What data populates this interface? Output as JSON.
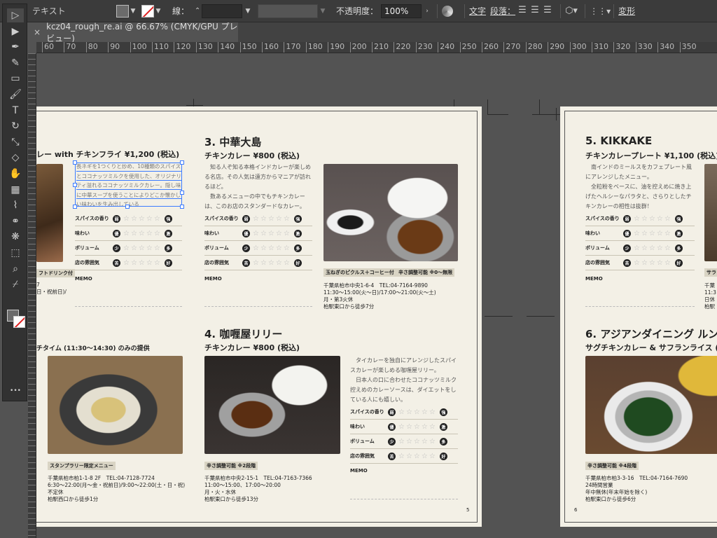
{
  "controlbar": {
    "label": "テキスト",
    "stroke_label": "線：",
    "opacity_label": "不透明度：",
    "opacity_value": "100%",
    "char_label": "文字",
    "para_label": "段落：",
    "transform_label": "変形"
  },
  "tab": {
    "close": "×",
    "title": "kcz04_rough_re.ai @ 66.67% (CMYK/GPU プレビュー)"
  },
  "ruler_ticks": [
    "60",
    "70",
    "80",
    "90",
    "100",
    "110",
    "120",
    "130",
    "140",
    "150",
    "160",
    "170",
    "180",
    "190",
    "200",
    "210",
    "220",
    "230",
    "240",
    "250",
    "260",
    "270",
    "280",
    "290",
    "300",
    "310",
    "320",
    "330",
    "340",
    "350"
  ],
  "tools": [
    {
      "name": "selection-tool-icon",
      "glyph": "▷"
    },
    {
      "name": "direct-selection-tool-icon",
      "glyph": "▶"
    },
    {
      "name": "pen-tool-icon",
      "glyph": "✒"
    },
    {
      "name": "curvature-tool-icon",
      "glyph": "✎"
    },
    {
      "name": "rectangle-tool-icon",
      "glyph": "▭"
    },
    {
      "name": "paintbrush-tool-icon",
      "glyph": "🖌"
    },
    {
      "name": "type-tool-icon",
      "glyph": "T"
    },
    {
      "name": "rotate-tool-icon",
      "glyph": "↻"
    },
    {
      "name": "scale-tool-icon",
      "glyph": "⤡"
    },
    {
      "name": "eraser-tool-icon",
      "glyph": "◇"
    },
    {
      "name": "puppet-warp-tool-icon",
      "glyph": "✋"
    },
    {
      "name": "gradient-tool-icon",
      "glyph": "▦"
    },
    {
      "name": "eyedropper-tool-icon",
      "glyph": "⌇"
    },
    {
      "name": "blend-tool-icon",
      "glyph": "⚭"
    },
    {
      "name": "symbol-sprayer-tool-icon",
      "glyph": "❋"
    },
    {
      "name": "artboard-tool-icon",
      "glyph": "⬚"
    },
    {
      "name": "zoom-tool-icon",
      "glyph": "⌕"
    },
    {
      "name": "eyedropper-2-tool-icon",
      "glyph": "⌿"
    }
  ],
  "menu": {
    "s1_title_partial": "レー with チキンフライ ¥1,200 (税込)",
    "s1_selected_text": "長ネギを1つくりと炒め、10種類のスパイスとココナッツミルクを使用した、オリジナリティ溢れるココナッツミルクカレー。隠し味に中華スープを使うことによりどこか懐かしい味わいを生み出している",
    "s1_tag_partial": "フトドリンク付",
    "s1_addr_partial1": "7",
    "s1_addr_partial2": "日・祝前日)/",
    "s1b_title_partial": "チタイム (11:30〜14:30) のみの提供",
    "s1b_tag": "スタンプラリー限定メニュー",
    "s1b_addr": "千葉県柏市柏1-1-8 2F　TEL:04-7128-7724\n6:30〜22:00(月〜金・祝前日)/9:00〜22:00(土・日・祝)\n不定休\n柏駅西口から徒歩1分",
    "s3_title": "3. 中華大島",
    "s3_sub": "チキンカレー ¥800 (税込)",
    "s3_body": "　知る人ぞ知る本格インドカレーが楽しめる名店。その人気は遠方からマニアが訪れるほど。\n　数あるメニューの中でもチキンカレーは、このお店のスタンダードなカレー。",
    "s3_tag1": "玉ねぎのピクルス＋コーヒー付",
    "s3_tag2": "辛さ調整可能 ※0〜無限",
    "s3_addr": "千葉県柏市中央1-6-4　TEL:04-7164-9890\n11:30〜15:00(火〜日)/17:00〜21:00(火〜土)\n月・第3火休\n柏駅東口から徒歩7分",
    "s4_title": "4. 咖喱屋リリー",
    "s4_sub": "チキンカレー ¥800 (税込)",
    "s4_body": "　タイカレーを独自にアレンジしたスパイスカレーが楽しめる咖喱屋リリー。\n　日本人の口に合わせたココナッツミルク控えめのカレーソースは、ダイエットをしている人にも嬉しい。",
    "s4_tag": "辛さ調整可能 ※2段階",
    "s4_addr": "千葉県柏市中央2-15-1　TEL:04-7163-7366\n11:00〜15:00、17:00〜20:00\n月・火・水休\n柏駅東口から徒歩13分",
    "s5_title": "5. KIKKAKE",
    "s5_sub": "チキンカレープレート ¥1,100 (税込)",
    "s5_body": "　南インドのミールスをカフェプレート風にアレンジしたメニュー。\n　全粒粉をベースに、油を控えめに焼き上げたヘルシーなパラタと、さらりとしたチキンカレーの相性は抜群！",
    "s5_tag_partial": "サラ",
    "s5_addr_partial": "千葉\n11:3\n日休\n柏駅",
    "s6_title": "6. アジアンダイニング ルン",
    "s6_sub": "サグチキンカレー & サフランライス (S)",
    "s6_tag": "辛さ調整可能 ※4段階",
    "s6_addr": "千葉県柏市柏3-3-16　TEL:04-7164-7690\n24時間営業\n年中無休(年末年始を除く)\n柏駅東口から徒歩6分",
    "memo": "MEMO",
    "page5": "5",
    "page6": "6"
  },
  "rating": {
    "labels": [
      "スパイスの香り",
      "味わい",
      "ボリューム",
      "店の雰囲気"
    ],
    "left": [
      "弱",
      "優",
      "少",
      "苦"
    ],
    "right": [
      "強",
      "激",
      "多",
      "好"
    ],
    "stars": "☆☆☆☆☆"
  },
  "colors": {
    "chrome_bg": "#3b3b3b",
    "canvas_bg": "#535353",
    "page_bg": "#f3f0e6",
    "selection": "#3b7bff"
  }
}
